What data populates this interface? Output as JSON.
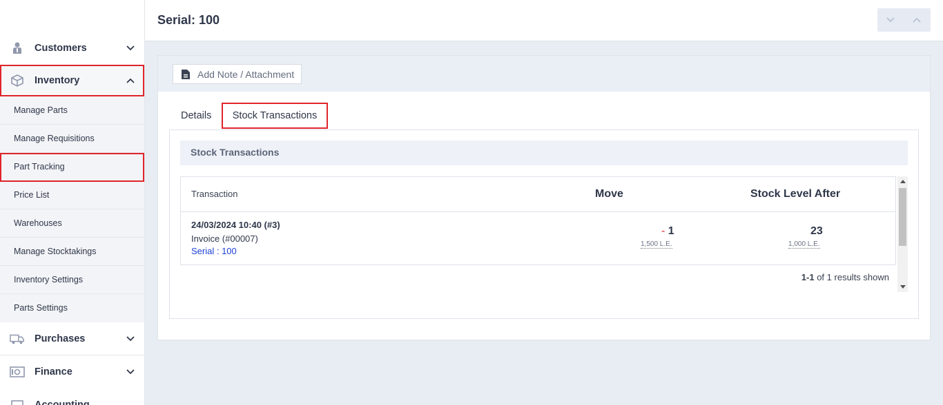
{
  "sidebar": {
    "items": [
      {
        "label": "Customers",
        "icon": "customers-icon",
        "expanded": false
      },
      {
        "label": "Inventory",
        "icon": "box-icon",
        "expanded": true
      },
      {
        "label": "Purchases",
        "icon": "truck-icon",
        "expanded": false
      },
      {
        "label": "Finance",
        "icon": "safe-icon",
        "expanded": false
      },
      {
        "label": "Accounting",
        "icon": "ledger-icon",
        "expanded": false
      }
    ],
    "inventory_submenu": [
      "Manage Parts",
      "Manage Requisitions",
      "Part Tracking",
      "Price List",
      "Warehouses",
      "Manage Stocktakings",
      "Inventory Settings",
      "Parts Settings"
    ]
  },
  "header": {
    "title": "Serial: 100"
  },
  "toolbar": {
    "note_label": "Add Note / Attachment"
  },
  "tabs": [
    {
      "label": "Details",
      "active": false
    },
    {
      "label": "Stock Transactions",
      "active": true
    }
  ],
  "section": {
    "title": "Stock Transactions"
  },
  "table": {
    "columns": [
      "Transaction",
      "Move",
      "Stock Level After"
    ],
    "rows": [
      {
        "date": "24/03/2024 10:40 (#3)",
        "doc": "Invoice (#00007)",
        "serial": "Serial : 100",
        "move_sign": "-",
        "move_qty": "1",
        "move_value": "1,500 L.E.",
        "stock_after": "23",
        "stock_value": "1,000 L.E."
      }
    ]
  },
  "pagination": {
    "range": "1-1",
    "of": "of",
    "total": "1",
    "suffix": "results shown"
  },
  "colors": {
    "highlight": "#e0242b",
    "link": "#1d3fd6",
    "text": "#2e3649"
  }
}
